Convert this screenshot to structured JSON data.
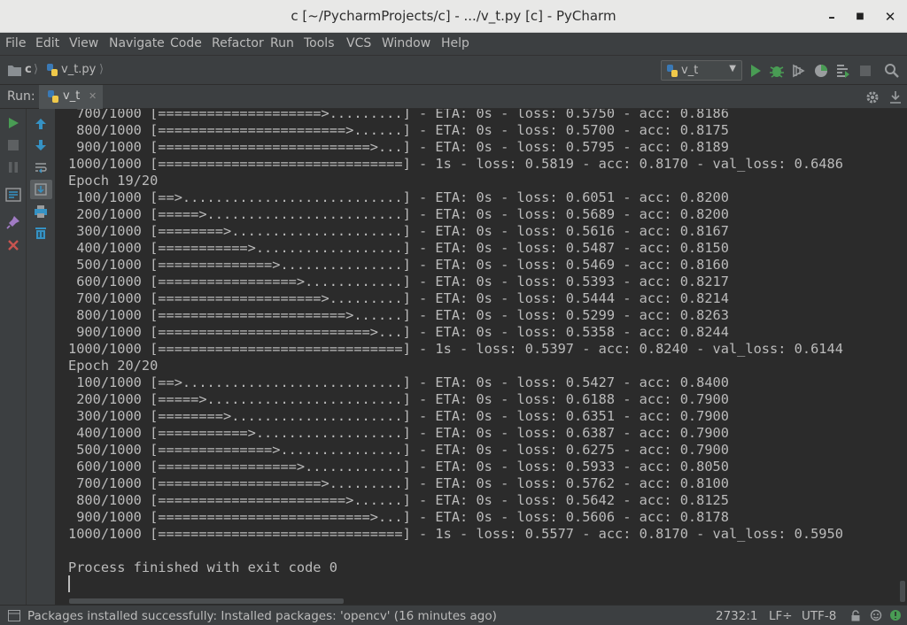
{
  "window": {
    "title": "c [~/PycharmProjects/c] - .../v_t.py [c] - PyCharm",
    "minimize": "–",
    "maximize": "■",
    "close": "✕"
  },
  "menu": [
    "File",
    "Edit",
    "View",
    "Navigate",
    "Code",
    "Refactor",
    "Run",
    "Tools",
    "VCS",
    "Window",
    "Help"
  ],
  "navbar": {
    "project": "c",
    "file": "v_t.py",
    "run_config": "v_t"
  },
  "run_panel": {
    "label": "Run:",
    "tab": "v_t"
  },
  "console": {
    "lines": [
      " 700/1000 [====================>.........] - ETA: 0s - loss: 0.5750 - acc: 0.8186",
      " 800/1000 [=======================>......] - ETA: 0s - loss: 0.5700 - acc: 0.8175",
      " 900/1000 [==========================>...] - ETA: 0s - loss: 0.5795 - acc: 0.8189",
      "1000/1000 [==============================] - 1s - loss: 0.5819 - acc: 0.8170 - val_loss: 0.6486",
      "Epoch 19/20",
      " 100/1000 [==>...........................] - ETA: 0s - loss: 0.6051 - acc: 0.8200",
      " 200/1000 [=====>........................] - ETA: 0s - loss: 0.5689 - acc: 0.8200",
      " 300/1000 [========>.....................] - ETA: 0s - loss: 0.5616 - acc: 0.8167",
      " 400/1000 [===========>..................] - ETA: 0s - loss: 0.5487 - acc: 0.8150",
      " 500/1000 [==============>...............] - ETA: 0s - loss: 0.5469 - acc: 0.8160",
      " 600/1000 [=================>............] - ETA: 0s - loss: 0.5393 - acc: 0.8217",
      " 700/1000 [====================>.........] - ETA: 0s - loss: 0.5444 - acc: 0.8214",
      " 800/1000 [=======================>......] - ETA: 0s - loss: 0.5299 - acc: 0.8263",
      " 900/1000 [==========================>...] - ETA: 0s - loss: 0.5358 - acc: 0.8244",
      "1000/1000 [==============================] - 1s - loss: 0.5397 - acc: 0.8240 - val_loss: 0.6144",
      "Epoch 20/20",
      " 100/1000 [==>...........................] - ETA: 0s - loss: 0.5427 - acc: 0.8400",
      " 200/1000 [=====>........................] - ETA: 0s - loss: 0.6188 - acc: 0.7900",
      " 300/1000 [========>.....................] - ETA: 0s - loss: 0.6351 - acc: 0.7900",
      " 400/1000 [===========>..................] - ETA: 0s - loss: 0.6387 - acc: 0.7900",
      " 500/1000 [==============>...............] - ETA: 0s - loss: 0.6275 - acc: 0.7900",
      " 600/1000 [=================>............] - ETA: 0s - loss: 0.5933 - acc: 0.8050",
      " 700/1000 [====================>.........] - ETA: 0s - loss: 0.5762 - acc: 0.8100",
      " 800/1000 [=======================>......] - ETA: 0s - loss: 0.5642 - acc: 0.8125",
      " 900/1000 [==========================>...] - ETA: 0s - loss: 0.5606 - acc: 0.8178",
      "1000/1000 [==============================] - 1s - loss: 0.5577 - acc: 0.8170 - val_loss: 0.5950",
      "",
      "Process finished with exit code 0"
    ]
  },
  "status": {
    "message": "Packages installed successfully: Installed packages: 'opencv' (16 minutes ago)",
    "position": "2732:1",
    "line_sep": "LF÷",
    "encoding": "UTF-8"
  },
  "colors": {
    "run_green": "#499c54",
    "stop_red": "#c75450",
    "accent_blue": "#3592c4",
    "python_yellow": "#f0c94a"
  }
}
